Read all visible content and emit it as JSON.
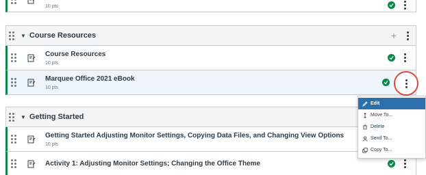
{
  "colors": {
    "published_green": "#0b874b",
    "highlight_circle": "#e0463a",
    "menu_active": "#2d6fab"
  },
  "top_item": {
    "points": "10 pts"
  },
  "modules": [
    {
      "title": "Course Resources",
      "items": [
        {
          "title": "Course Resources",
          "points": "10 pts"
        },
        {
          "title": "Marquee Office 2021 eBook",
          "points": "10 pts"
        }
      ]
    },
    {
      "title": "Getting Started",
      "items": [
        {
          "title": "Getting Started Adjusting Monitor Settings, Copying Data Files, and Changing View Options",
          "points": "10 pts"
        },
        {
          "title": "Activity 1: Adjusting Monitor Settings; Changing the Office Theme",
          "points": ""
        }
      ]
    }
  ],
  "context_menu": {
    "items": [
      {
        "label": "Edit",
        "icon": "pencil-icon"
      },
      {
        "label": "Move To...",
        "icon": "move-arrows-icon"
      },
      {
        "label": "Delete",
        "icon": "trash-icon"
      },
      {
        "label": "Send To...",
        "icon": "user-icon"
      },
      {
        "label": "Copy To...",
        "icon": "copy-icon"
      }
    ]
  }
}
